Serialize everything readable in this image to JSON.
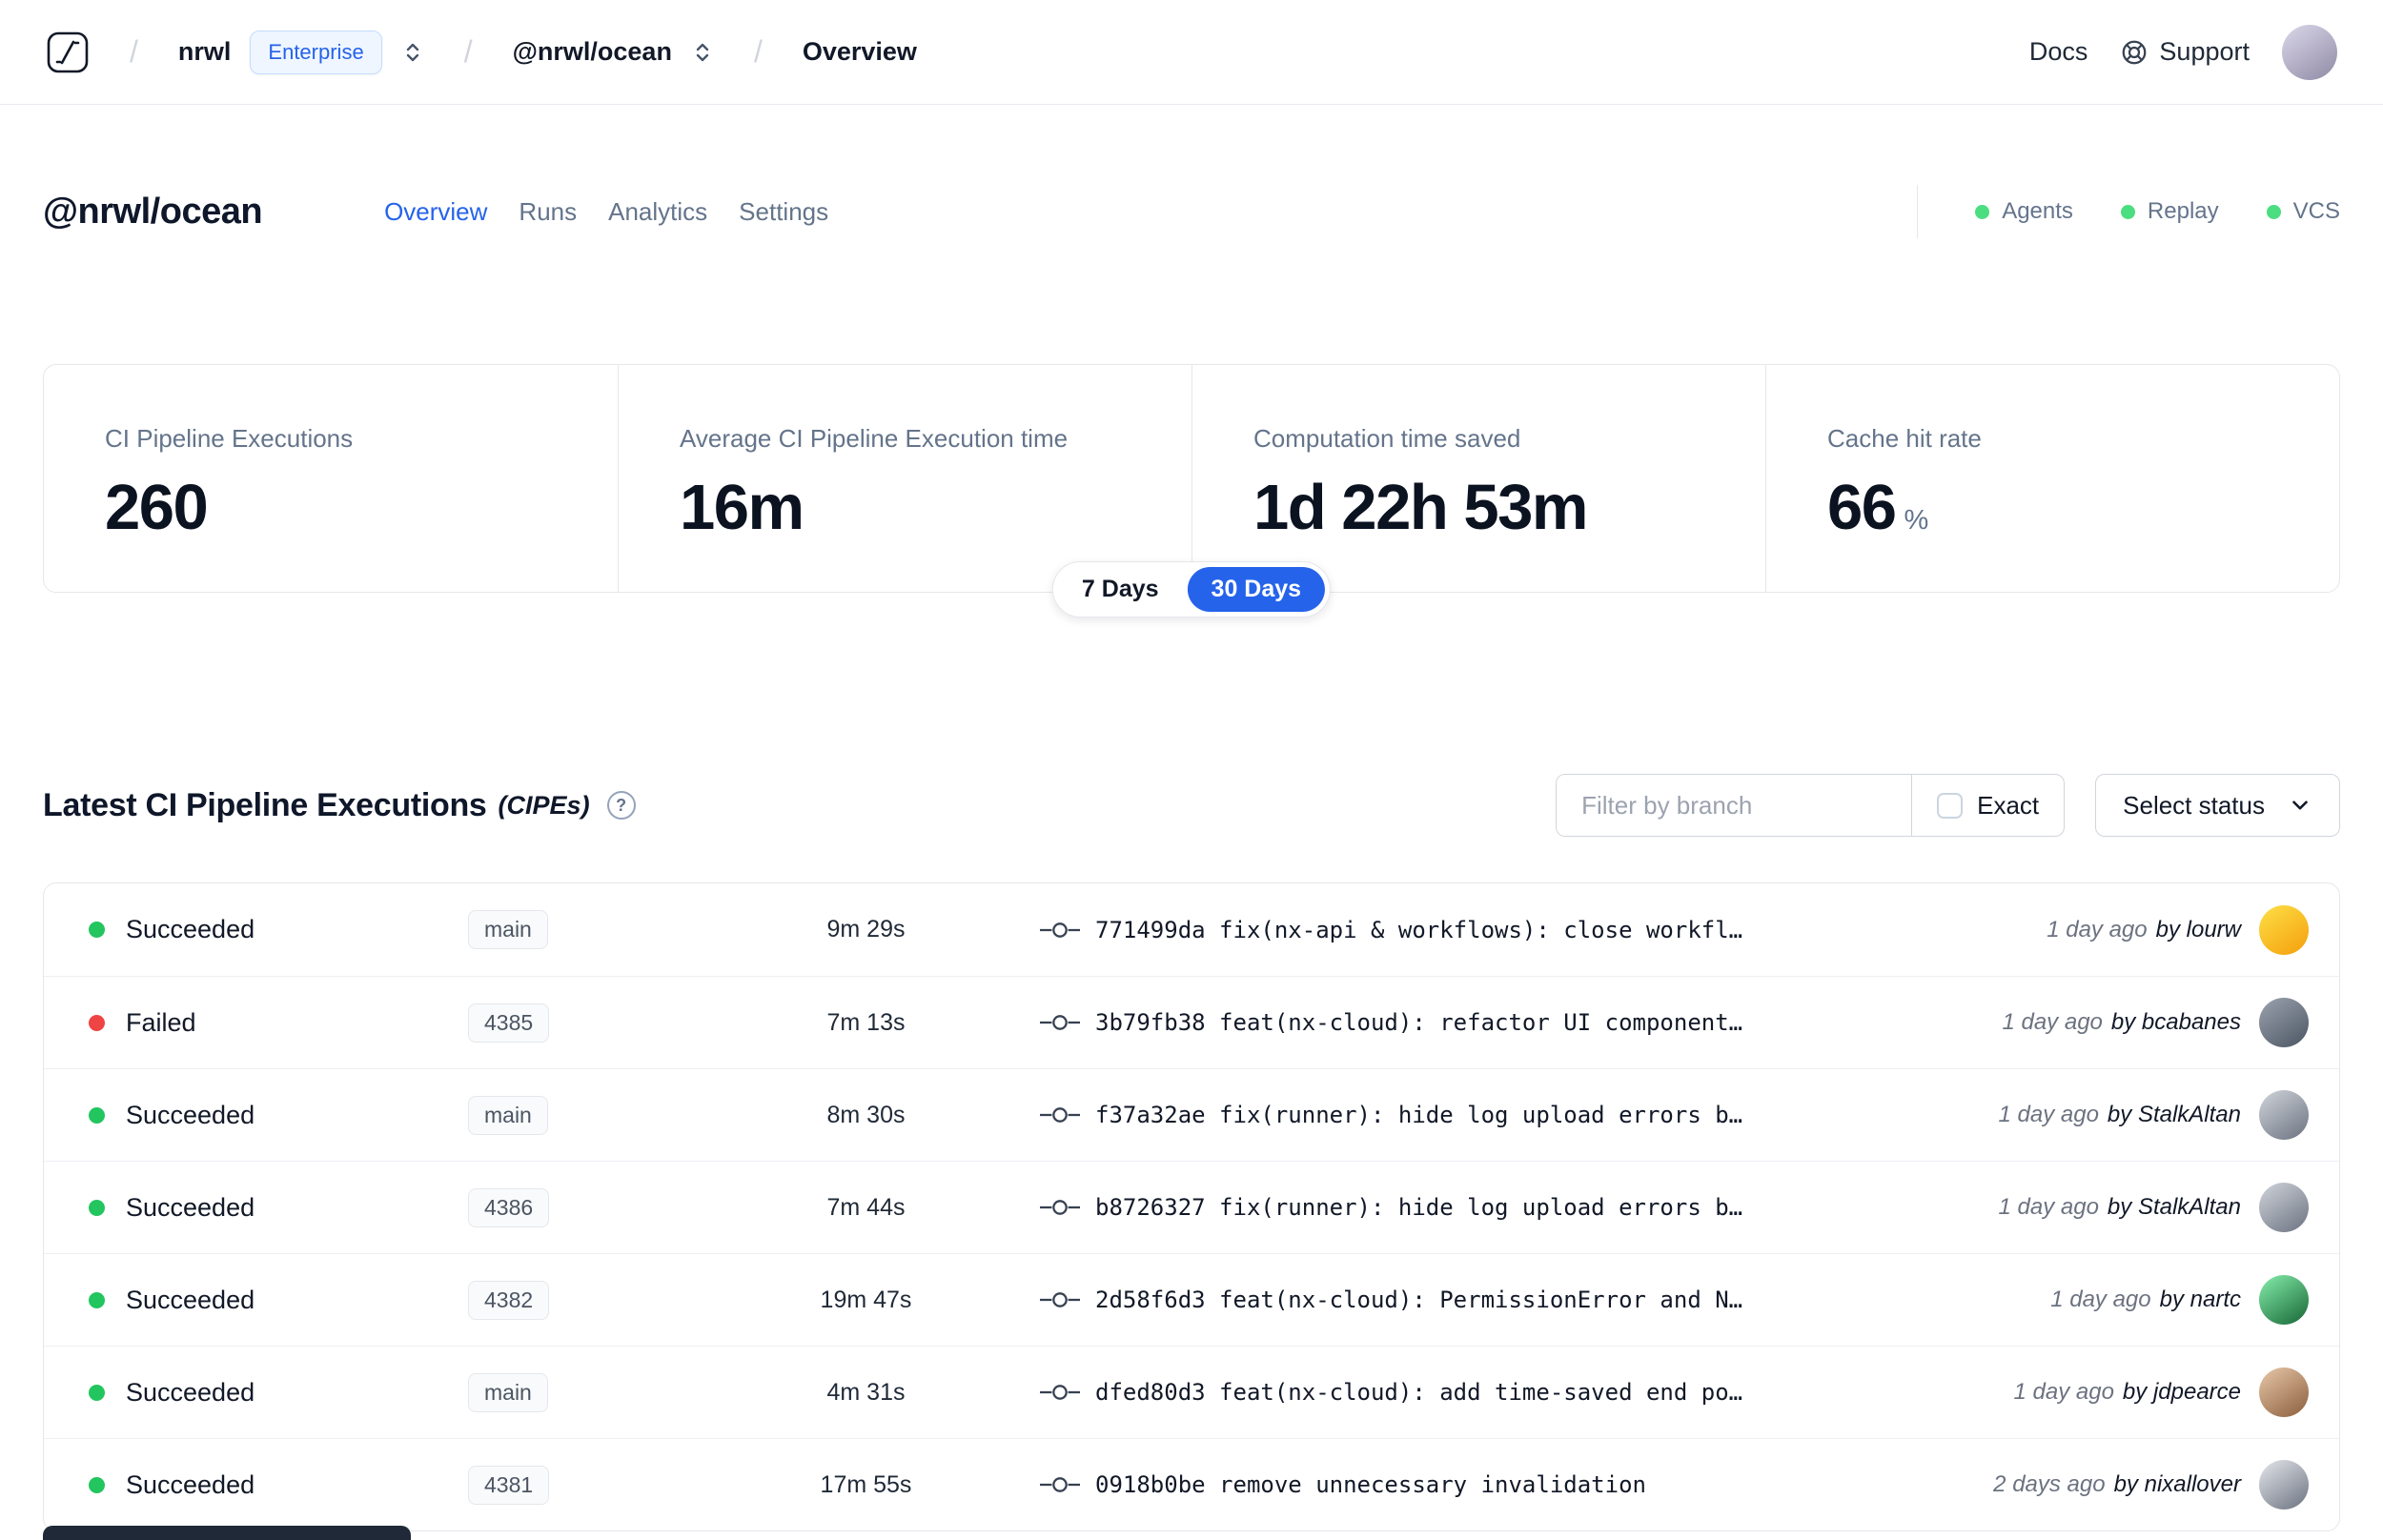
{
  "navbar": {
    "separator": "/",
    "org": "nrwl",
    "badge": "Enterprise",
    "workspace": "@nrwl/ocean",
    "page": "Overview",
    "docs": "Docs",
    "support": "Support"
  },
  "header": {
    "title": "@nrwl/ocean",
    "tabs": [
      {
        "label": "Overview"
      },
      {
        "label": "Runs"
      },
      {
        "label": "Analytics"
      },
      {
        "label": "Settings"
      }
    ],
    "indicators": [
      {
        "label": "Agents"
      },
      {
        "label": "Replay"
      },
      {
        "label": "VCS"
      }
    ],
    "indicator_color": "#4ade80"
  },
  "stats": {
    "cards": [
      {
        "label": "CI Pipeline Executions",
        "value": "260",
        "suffix": ""
      },
      {
        "label": "Average CI Pipeline Execution time",
        "value": "16m",
        "suffix": ""
      },
      {
        "label": "Computation time saved",
        "value": "1d 22h 53m",
        "suffix": ""
      },
      {
        "label": "Cache hit rate",
        "value": "66",
        "suffix": "%"
      }
    ],
    "range": [
      {
        "label": "7 Days"
      },
      {
        "label": "30 Days"
      }
    ],
    "accent": "#2563eb"
  },
  "section": {
    "title": "Latest CI Pipeline Executions",
    "title_suffix": "(CIPEs)",
    "filter_placeholder": "Filter by branch",
    "exact_label": "Exact",
    "status_button": "Select status"
  },
  "icons": {
    "help": "?"
  },
  "table": {
    "rows": [
      {
        "status": "Succeeded",
        "status_color": "#22c55e",
        "branch": "main",
        "duration": "9m 29s",
        "commit": "771499da fix(nx-api & workflows): close workfl…",
        "time": "1 day ago",
        "author": "by lourw",
        "avatar": [
          "#fde047",
          "#f59e0b"
        ]
      },
      {
        "status": "Failed",
        "status_color": "#ef4444",
        "branch": "4385",
        "duration": "7m 13s",
        "commit": "3b79fb38 feat(nx-cloud): refactor UI component…",
        "time": "1 day ago",
        "author": "by bcabanes",
        "avatar": [
          "#9ca3af",
          "#4b5563"
        ]
      },
      {
        "status": "Succeeded",
        "status_color": "#22c55e",
        "branch": "main",
        "duration": "8m 30s",
        "commit": "f37a32ae fix(runner): hide log upload errors b…",
        "time": "1 day ago",
        "author": "by StalkAltan",
        "avatar": [
          "#d1d5db",
          "#6b7280"
        ]
      },
      {
        "status": "Succeeded",
        "status_color": "#22c55e",
        "branch": "4386",
        "duration": "7m 44s",
        "commit": "b8726327 fix(runner): hide log upload errors b…",
        "time": "1 day ago",
        "author": "by StalkAltan",
        "avatar": [
          "#d1d5db",
          "#6b7280"
        ]
      },
      {
        "status": "Succeeded",
        "status_color": "#22c55e",
        "branch": "4382",
        "duration": "19m 47s",
        "commit": "2d58f6d3 feat(nx-cloud): PermissionError and N…",
        "time": "1 day ago",
        "author": "by nartc",
        "avatar": [
          "#86efac",
          "#166534"
        ]
      },
      {
        "status": "Succeeded",
        "status_color": "#22c55e",
        "branch": "main",
        "duration": "4m 31s",
        "commit": "dfed80d3 feat(nx-cloud): add time-saved end po…",
        "time": "1 day ago",
        "author": "by jdpearce",
        "avatar": [
          "#e8c8a9",
          "#8b5e3c"
        ]
      },
      {
        "status": "Succeeded",
        "status_color": "#22c55e",
        "branch": "4381",
        "duration": "17m 55s",
        "commit": "0918b0be remove unnecessary invalidation",
        "time": "2 days ago",
        "author": "by nixallover",
        "avatar": [
          "#e5e7eb",
          "#6b7280"
        ]
      }
    ]
  }
}
